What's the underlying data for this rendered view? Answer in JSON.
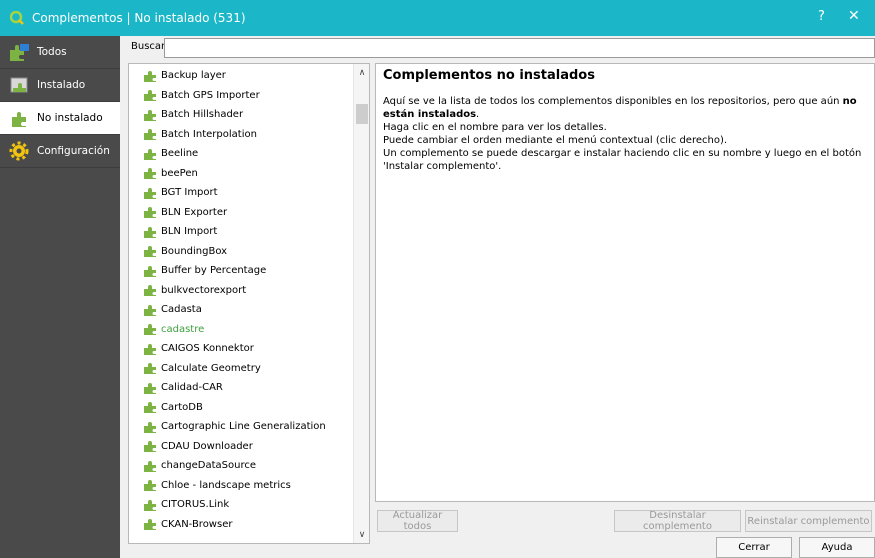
{
  "window": {
    "title": "Complementos | No instalado (531)",
    "help": "?",
    "close": "✕"
  },
  "sidebar": {
    "items": [
      {
        "label": "Todos",
        "icon": "puzzle-icon",
        "active": false
      },
      {
        "label": "Instalado",
        "icon": "installed-icon",
        "active": false
      },
      {
        "label": "No instalado",
        "icon": "not-installed-icon",
        "active": true
      },
      {
        "label": "Configuración",
        "icon": "gear-icon",
        "active": false
      }
    ]
  },
  "search": {
    "label": "Buscar",
    "value": ""
  },
  "plugins": [
    {
      "name": "Backup layer"
    },
    {
      "name": "Batch GPS Importer"
    },
    {
      "name": "Batch Hillshader"
    },
    {
      "name": "Batch Interpolation"
    },
    {
      "name": "Beeline"
    },
    {
      "name": "beePen"
    },
    {
      "name": "BGT Import"
    },
    {
      "name": "BLN Exporter"
    },
    {
      "name": "BLN Import"
    },
    {
      "name": "BoundingBox"
    },
    {
      "name": "Buffer by Percentage"
    },
    {
      "name": "bulkvectorexport"
    },
    {
      "name": "Cadasta"
    },
    {
      "name": "cadastre",
      "green": true
    },
    {
      "name": "CAIGOS Konnektor"
    },
    {
      "name": "Calculate Geometry"
    },
    {
      "name": "Calidad-CAR"
    },
    {
      "name": "CartoDB"
    },
    {
      "name": "Cartographic Line Generalization"
    },
    {
      "name": "CDAU Downloader"
    },
    {
      "name": "changeDataSource"
    },
    {
      "name": "Chloe - landscape metrics"
    },
    {
      "name": "CITORUS.Link"
    },
    {
      "name": "CKAN-Browser"
    }
  ],
  "detail": {
    "title": "Complementos no instalados",
    "line1_pre": "Aquí se ve la lista de todos los complementos disponibles en los repositorios, pero que aún ",
    "line1_bold": "no están instalados",
    "line1_post": ".",
    "line2": "Haga clic en el nombre para ver los detalles.",
    "line3": "Puede cambiar el orden mediante el menú contextual (clic derecho).",
    "line4": "Un complemento se puede descargar e instalar haciendo clic en su nombre y luego en el botón 'Instalar complemento'."
  },
  "buttons": {
    "update_all": "Actualizar todos",
    "uninstall": "Desinstalar complemento",
    "reinstall": "Reinstalar complemento",
    "close": "Cerrar",
    "help": "Ayuda"
  },
  "colors": {
    "titlebar": "#1bb7c9",
    "sidebar": "#4a4a4a",
    "plugin_icon": "#7cb342",
    "highlight_text": "#3e9f3e"
  }
}
